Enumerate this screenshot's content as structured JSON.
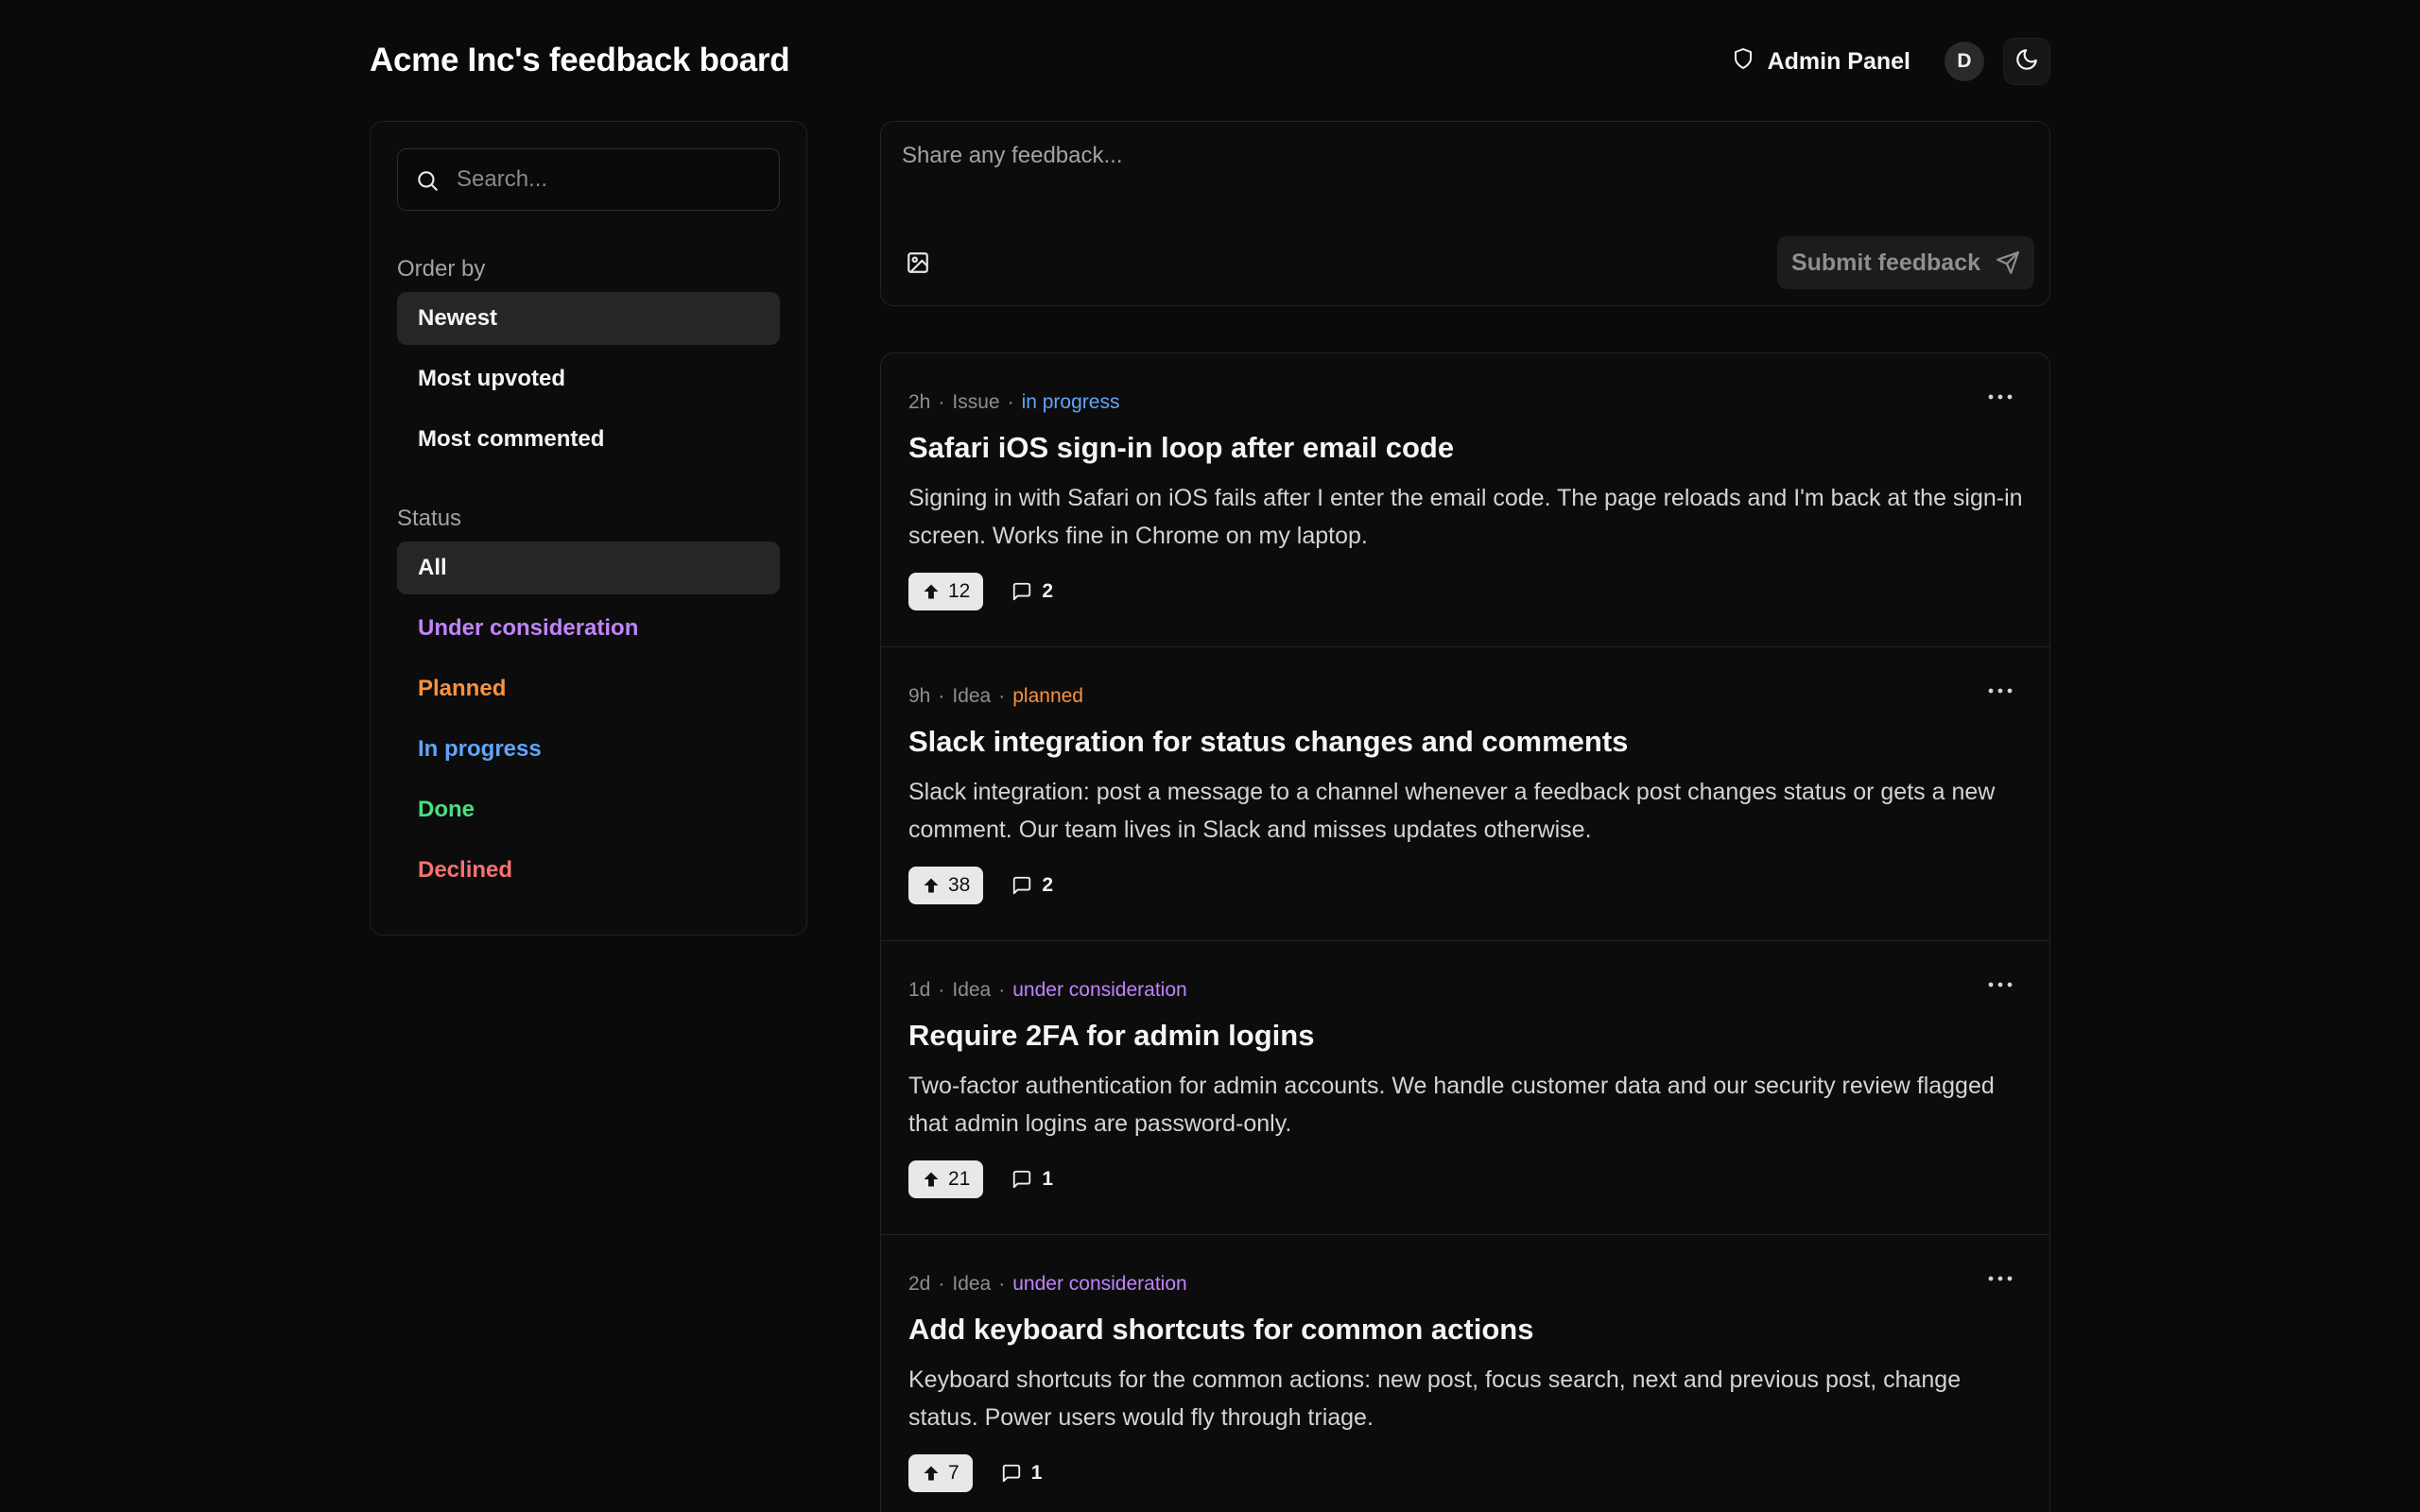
{
  "header": {
    "title": "Acme Inc's feedback board",
    "admin_label": "Admin Panel",
    "avatar_initial": "D"
  },
  "sidebar": {
    "search_placeholder": "Search...",
    "order_label": "Order by",
    "order_options": [
      {
        "label": "Newest",
        "active": true
      },
      {
        "label": "Most upvoted",
        "active": false
      },
      {
        "label": "Most commented",
        "active": false
      }
    ],
    "status_label": "Status",
    "status_options": [
      {
        "label": "All",
        "color": "#f5f5f5",
        "active": true
      },
      {
        "label": "Under consideration",
        "color": "#c084fc",
        "active": false
      },
      {
        "label": "Planned",
        "color": "#fb923c",
        "active": false
      },
      {
        "label": "In progress",
        "color": "#60a5fa",
        "active": false
      },
      {
        "label": "Done",
        "color": "#4ade80",
        "active": false
      },
      {
        "label": "Declined",
        "color": "#f87171",
        "active": false
      }
    ]
  },
  "composer": {
    "placeholder": "Share any feedback...",
    "submit_label": "Submit feedback"
  },
  "posts": [
    {
      "age": "2h",
      "type": "Issue",
      "status": "in progress",
      "status_color": "#60a5fa",
      "title": "Safari iOS sign-in loop after email code",
      "body": "Signing in with Safari on iOS fails after I enter the email code. The page reloads and I'm back at the sign-in screen. Works fine in Chrome on my laptop.",
      "votes": "12",
      "comments": "2"
    },
    {
      "age": "9h",
      "type": "Idea",
      "status": "planned",
      "status_color": "#fb923c",
      "title": "Slack integration for status changes and comments",
      "body": "Slack integration: post a message to a channel whenever a feedback post changes status or gets a new comment. Our team lives in Slack and misses updates otherwise.",
      "votes": "38",
      "comments": "2"
    },
    {
      "age": "1d",
      "type": "Idea",
      "status": "under consideration",
      "status_color": "#c084fc",
      "title": "Require 2FA for admin logins",
      "body": "Two-factor authentication for admin accounts. We handle customer data and our security review flagged that admin logins are password-only.",
      "votes": "21",
      "comments": "1"
    },
    {
      "age": "2d",
      "type": "Idea",
      "status": "under consideration",
      "status_color": "#c084fc",
      "title": "Add keyboard shortcuts for common actions",
      "body": "Keyboard shortcuts for the common actions: new post, focus search, next and previous post, change status. Power users would fly through triage.",
      "votes": "7",
      "comments": "1"
    }
  ]
}
